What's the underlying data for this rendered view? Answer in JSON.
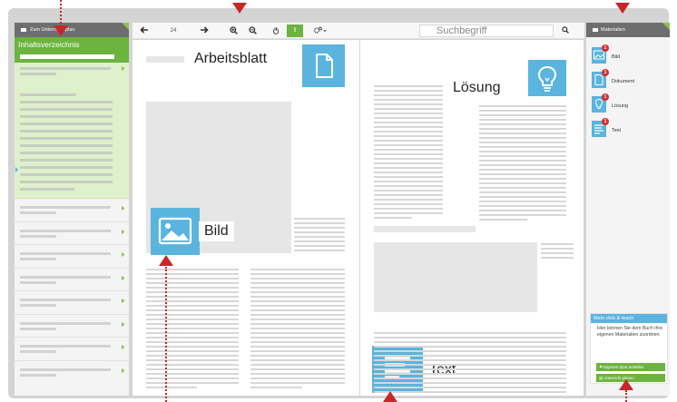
{
  "left_sidebar": {
    "title": "Zum Unterrichtsplan",
    "tab": "Inhaltsverzeichnis"
  },
  "toolbar": {
    "page_number": "24",
    "prev_icon": "arrow-left-icon",
    "next_icon": "arrow-right-icon",
    "zoom_in_icon": "zoom-in-icon",
    "zoom_out_icon": "zoom-out-icon",
    "hand_icon": "hand-icon",
    "text_tool_label": "I",
    "settings_icon": "gear-icon",
    "search_placeholder": "Suchbegriff"
  },
  "page_left": {
    "worksheet_label": "Arbeitsblatt",
    "image_label": "Bild"
  },
  "page_right": {
    "solution_label": "Lösung",
    "text_label": "Text"
  },
  "right_sidebar": {
    "title": "Materialien",
    "items": [
      {
        "label": "Bild",
        "badge": "1",
        "icon": "image-icon"
      },
      {
        "label": "Dokument",
        "badge": "1",
        "icon": "document-icon"
      },
      {
        "label": "Lösung",
        "badge": "1",
        "icon": "lightbulb-icon"
      },
      {
        "label": "Text",
        "badge": "1",
        "icon": "text-icon"
      }
    ],
    "click_teach": {
      "title": "Mein click & teach",
      "text": "Hier können Sie dem Buch Ihre eigenen Materialien zuordnen.",
      "btn_spot": "Eigenen Spot erstellen",
      "btn_material": "Unterricht planen"
    }
  },
  "colors": {
    "green": "#6cb33f",
    "blue": "#5ab4de",
    "arrow_red": "#c62828",
    "header_gray": "#6e6e6e"
  }
}
